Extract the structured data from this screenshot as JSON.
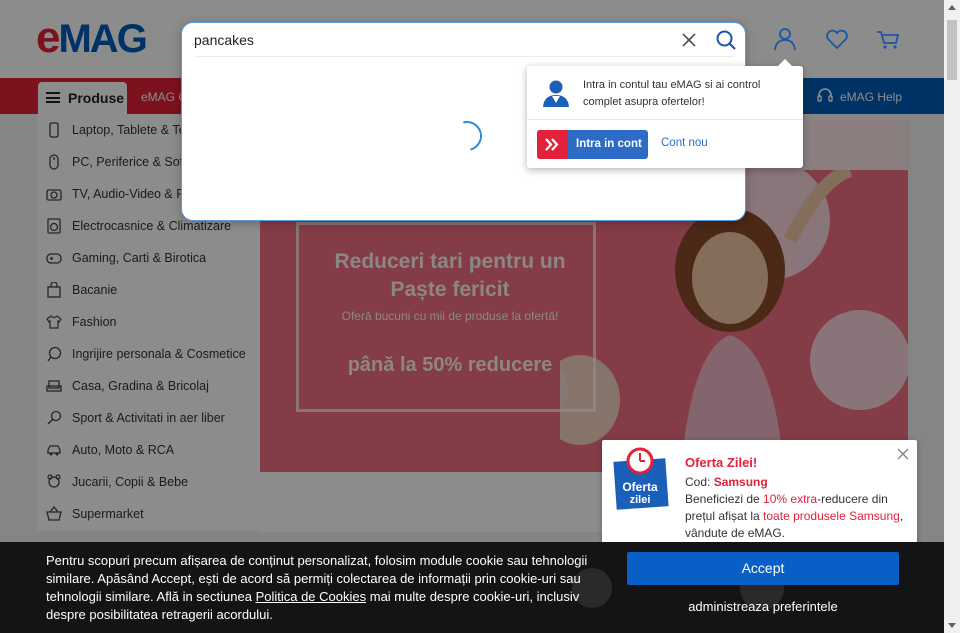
{
  "header": {
    "logo_e": "e",
    "logo_rest": "MAG"
  },
  "search": {
    "value": "pancakes",
    "placeholder": "",
    "state": "loading"
  },
  "nav": {
    "produse_label": "Produse",
    "emag_item": "eMAG G",
    "help_label": "eMAG Help"
  },
  "sidebar": {
    "items": [
      {
        "label": "Laptop, Tablete & Te",
        "icon": "phone-icon"
      },
      {
        "label": "PC, Periferice & Soft",
        "icon": "mouse-icon"
      },
      {
        "label": "TV, Audio-Video & F",
        "icon": "camera-icon"
      },
      {
        "label": "Electrocasnice & Climatizare",
        "icon": "washer-icon"
      },
      {
        "label": "Gaming, Carti & Birotica",
        "icon": "gamepad-icon"
      },
      {
        "label": "Bacanie",
        "icon": "bag-icon"
      },
      {
        "label": "Fashion",
        "icon": "shirt-icon"
      },
      {
        "label": "Ingrijire personala & Cosmetice",
        "icon": "cosmetics-icon"
      },
      {
        "label": "Casa, Gradina & Bricolaj",
        "icon": "sofa-icon"
      },
      {
        "label": "Sport & Activitati in aer liber",
        "icon": "racket-icon"
      },
      {
        "label": "Auto, Moto & RCA",
        "icon": "car-icon"
      },
      {
        "label": "Jucarii, Copii & Bebe",
        "icon": "toy-icon"
      },
      {
        "label": "Supermarket",
        "icon": "basket-icon"
      }
    ]
  },
  "banner": {
    "title": "Reduceri tari pentru un Paște fericit",
    "subtitle": "Oferă bucurii cu mii de produse la ofertă!",
    "deal": "până la 50% reducere"
  },
  "account_popover": {
    "message": "Intra in contul tau eMAG si ai control complet asupra ofertelor!",
    "login_label": "Intra in cont",
    "signup_label": "Cont nou"
  },
  "offer": {
    "badge_line1": "Oferta",
    "badge_line2": "zilei",
    "title": "Oferta Zilei!",
    "code_prefix": "Cod: ",
    "code_value": "Samsung",
    "body_1": "Beneficiezi de ",
    "body_hl1": "10% extra",
    "body_2": "-reducere din prețul afișat la ",
    "body_hl2": "toate produsele Samsung",
    "body_3": ", vândute de eMAG."
  },
  "cookie": {
    "text_1": "Pentru scopuri precum afișarea de conținut personalizat, folosim module cookie sau tehnologii similare. Apăsând Accept, ești de acord să permiți colectarea de informații prin cookie-uri sau tehnologii similare. Află in sectiunea ",
    "link_label": "Politica de Cookies",
    "text_2": " mai multe despre cookie-uri, inclusiv despre posibilitatea retragerii acordului.",
    "accept_label": "Accept",
    "prefs_label": "administreaza preferintele"
  },
  "colors": {
    "brand_red": "#e3213a",
    "brand_blue": "#005eb8",
    "accept_blue": "#0a5fc6",
    "banner_pink": "#f06d80"
  }
}
